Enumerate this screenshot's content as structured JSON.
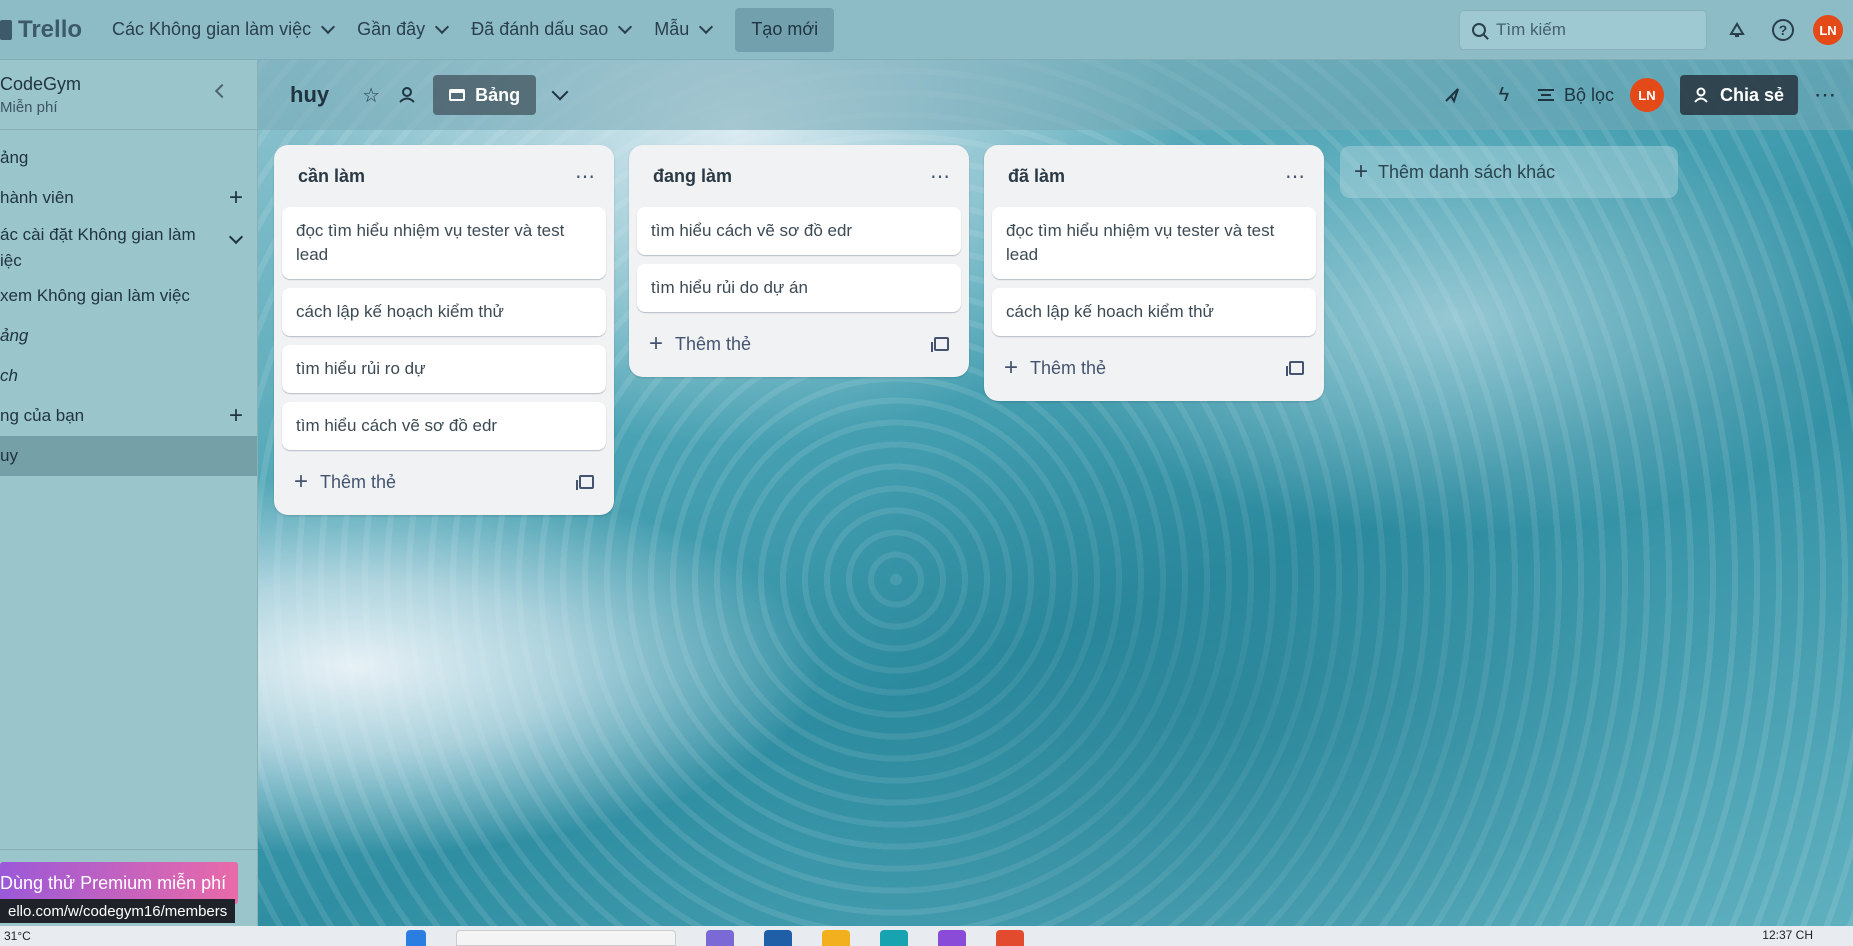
{
  "topbar": {
    "logo": "Trello",
    "nav": [
      "Các Không gian làm việc",
      "Gần đây",
      "Đã đánh dấu sao",
      "Mẫu"
    ],
    "create": "Tạo mới",
    "search_placeholder": "Tìm kiếm",
    "avatar": "LN"
  },
  "sidebar": {
    "workspace_name": "CodeGym",
    "workspace_plan": "Miễn phí",
    "items": [
      {
        "label": "ảng"
      },
      {
        "label": "hành viên"
      },
      {
        "label": "ác cài đặt Không gian làm",
        "label2": "iệc"
      },
      {
        "label": "xem Không gian làm việc"
      },
      {
        "label": "ảng"
      },
      {
        "label": "ch"
      },
      {
        "label": "ng của bạn"
      },
      {
        "label": "uy"
      }
    ],
    "premium": "Dùng thử Premium miễn phí"
  },
  "board": {
    "title": "huy",
    "view": "Bảng",
    "filter": "Bộ lọc",
    "share": "Chia sẻ",
    "avatar": "LN",
    "add_list": "Thêm danh sách khác"
  },
  "lists": [
    {
      "title": "cần làm",
      "cards": [
        "đọc tìm hiểu nhiệm vụ tester và test lead",
        "cách lập kế hoạch kiểm thử",
        "tìm hiểu rủi ro dự",
        "tìm hiểu cách vẽ sơ đồ edr"
      ],
      "add": "Thêm thẻ"
    },
    {
      "title": "đang làm",
      "cards": [
        "tìm hiểu cách vẽ sơ đồ edr",
        "tìm hiểu rủi do dự án"
      ],
      "add": "Thêm thẻ"
    },
    {
      "title": "đã làm",
      "cards": [
        "đọc tìm hiểu nhiệm vụ tester và test lead",
        "cách lập kế hoach kiểm thử"
      ],
      "add": "Thêm thẻ"
    }
  ],
  "status_url": "ello.com/w/codegym16/members",
  "taskbar": {
    "temp": "31°C",
    "time": "12:37 CH"
  }
}
